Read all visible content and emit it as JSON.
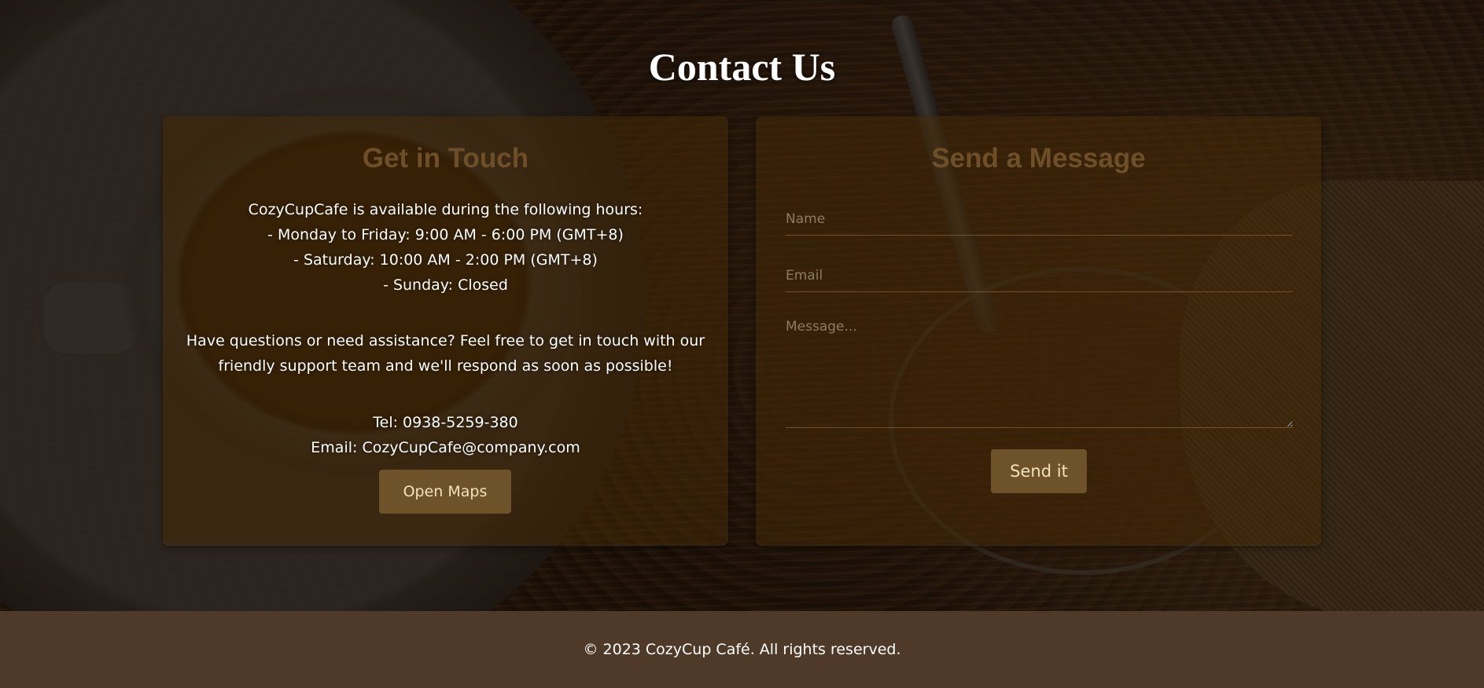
{
  "page": {
    "title": "Contact Us"
  },
  "get_in_touch": {
    "heading": "Get in Touch",
    "hours_lines": [
      "CozyCupCafe is available during the following hours:",
      "- Monday to Friday: 9:00 AM - 6:00 PM (GMT+8)",
      "- Saturday: 10:00 AM - 2:00 PM (GMT+8)",
      "- Sunday: Closed"
    ],
    "assist_lines": [
      "Have questions or need assistance? Feel free to get in touch with our",
      "friendly support team and we'll respond as soon as possible!"
    ],
    "tel": "Tel: 0938-5259-380",
    "email": "Email: CozyCupCafe@company.com",
    "maps_button": "Open Maps"
  },
  "send_message": {
    "heading": "Send a Message",
    "name_placeholder": "Name",
    "email_placeholder": "Email",
    "message_placeholder": "Message...",
    "send_button": "Send it"
  },
  "footer": {
    "text": "© 2023 CozyCup Café. All rights reserved."
  },
  "colors": {
    "heading_brown": "#6e4f28",
    "button_brown": "#6e5229",
    "footer_bg": "#4f3a2a"
  }
}
